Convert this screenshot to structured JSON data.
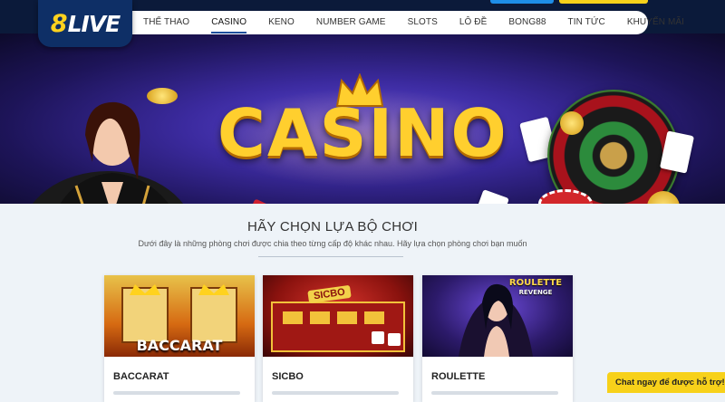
{
  "brand": {
    "logo_number": "8",
    "logo_text": "LIVE"
  },
  "nav": {
    "items": [
      {
        "label": "THỂ THAO"
      },
      {
        "label": "CASINO"
      },
      {
        "label": "KENO"
      },
      {
        "label": "NUMBER GAME"
      },
      {
        "label": "SLOTS"
      },
      {
        "label": "LÔ ĐỀ"
      },
      {
        "label": "BONG88"
      },
      {
        "label": "TIN TỨC"
      },
      {
        "label": "KHUYẾN MÃI"
      }
    ],
    "active": "CASINO"
  },
  "banner": {
    "title": "CASINO"
  },
  "section": {
    "title": "HÃY CHỌN LỰA BỘ CHƠI",
    "subtitle": "Dưới đây là những phòng chơi được chia theo từng cấp độ khác nhau. Hãy lựa chọn phòng chơi bạn muốn"
  },
  "games": [
    {
      "name": "BACCARAT",
      "thumb_label": "BACCARAT"
    },
    {
      "name": "SICBO",
      "thumb_label": "SICBO"
    },
    {
      "name": "ROULETTE",
      "thumb_label": "ROULETTE",
      "thumb_sublabel": "REVENGE"
    }
  ],
  "chat": {
    "label": "Chat ngay để được hỗ trợ!"
  },
  "colors": {
    "header_bg": "#0b1a3a",
    "logo_bg": "#0e2f66",
    "accent_yellow": "#f7d11a",
    "accent_blue": "#1e8ee8",
    "page_bg": "#eef3f8"
  }
}
